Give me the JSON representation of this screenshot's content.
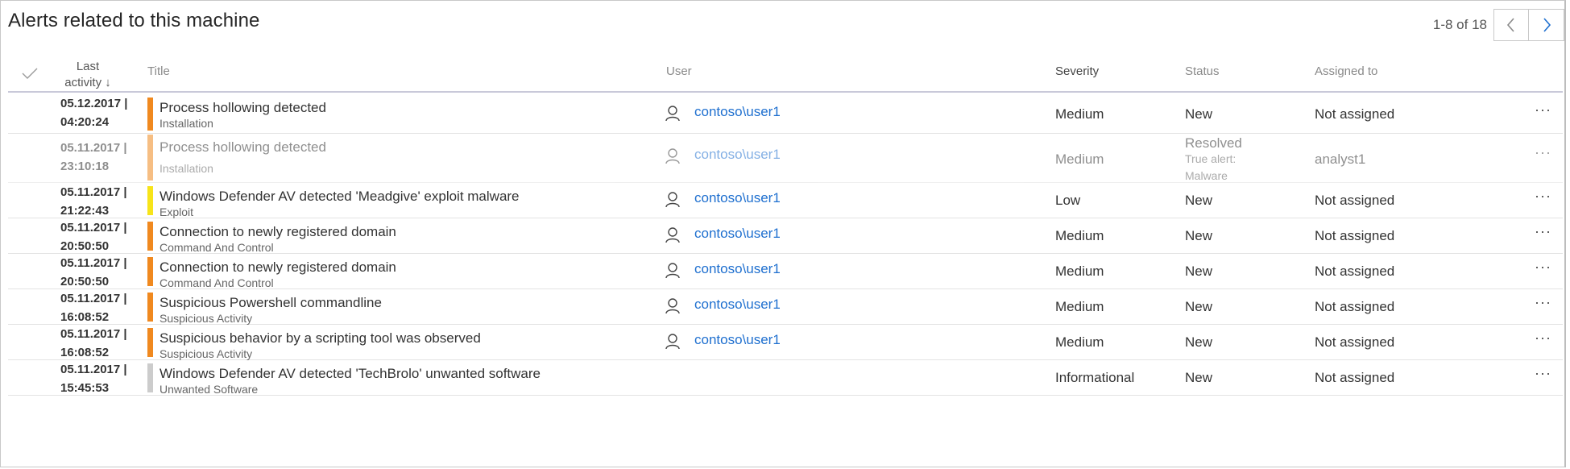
{
  "header": {
    "title": "Alerts related to this machine",
    "pager_text": "1-8 of 18"
  },
  "columns": {
    "activity_line1": "Last",
    "activity_line2": "activity ↓",
    "title": "Title",
    "user": "User",
    "severity": "Severity",
    "status": "Status",
    "assigned": "Assigned to"
  },
  "icons": {
    "select_all": "checkmark-icon",
    "prev": "chevron-left-icon",
    "next": "chevron-right-icon",
    "user": "user-icon",
    "more": "more-icon"
  },
  "colors": {
    "severity_medium": "#f0891f",
    "severity_low": "#f7e41a",
    "severity_informational": "#cccccc",
    "link": "#1e6fcf"
  },
  "more_glyph": "···",
  "rows": [
    {
      "date": "05.12.2017 |",
      "time": "04:20:24",
      "title": "Process hollowing detected",
      "category": "Installation",
      "user": "contoso\\user1",
      "severity": "Medium",
      "status": "New",
      "status_detail1": "",
      "status_detail2": "",
      "assigned": "Not assigned",
      "bar_color": "#f0891f",
      "dimmed": false
    },
    {
      "date": "05.11.2017 |",
      "time": "23:10:18",
      "title": "Process hollowing detected",
      "category": "Installation",
      "user": "contoso\\user1",
      "severity": "Medium",
      "status": "Resolved",
      "status_detail1": "True alert:",
      "status_detail2": "Malware",
      "assigned": "analyst1",
      "bar_color": "#f0891f",
      "dimmed": true
    },
    {
      "date": "05.11.2017 |",
      "time": "21:22:43",
      "title": "Windows Defender AV detected 'Meadgive' exploit malware",
      "category": "Exploit",
      "user": "contoso\\user1",
      "severity": "Low",
      "status": "New",
      "status_detail1": "",
      "status_detail2": "",
      "assigned": "Not assigned",
      "bar_color": "#f7e41a",
      "dimmed": false
    },
    {
      "date": "05.11.2017 |",
      "time": "20:50:50",
      "title": "Connection to newly registered domain",
      "category": "Command And Control",
      "user": "contoso\\user1",
      "severity": "Medium",
      "status": "New",
      "status_detail1": "",
      "status_detail2": "",
      "assigned": "Not assigned",
      "bar_color": "#f0891f",
      "dimmed": false
    },
    {
      "date": "05.11.2017 |",
      "time": "20:50:50",
      "title": "Connection to newly registered domain",
      "category": "Command And Control",
      "user": "contoso\\user1",
      "severity": "Medium",
      "status": "New",
      "status_detail1": "",
      "status_detail2": "",
      "assigned": "Not assigned",
      "bar_color": "#f0891f",
      "dimmed": false
    },
    {
      "date": "05.11.2017 |",
      "time": "16:08:52",
      "title": "Suspicious Powershell commandline",
      "category": "Suspicious Activity",
      "user": "contoso\\user1",
      "severity": "Medium",
      "status": "New",
      "status_detail1": "",
      "status_detail2": "",
      "assigned": "Not assigned",
      "bar_color": "#f0891f",
      "dimmed": false
    },
    {
      "date": "05.11.2017 |",
      "time": "16:08:52",
      "title": "Suspicious behavior by a scripting tool was observed",
      "category": "Suspicious Activity",
      "user": "contoso\\user1",
      "severity": "Medium",
      "status": "New",
      "status_detail1": "",
      "status_detail2": "",
      "assigned": "Not assigned",
      "bar_color": "#f0891f",
      "dimmed": false
    },
    {
      "date": "05.11.2017 |",
      "time": "15:45:53",
      "title": "Windows Defender AV detected 'TechBrolo' unwanted software",
      "category": "Unwanted Software",
      "user": "",
      "severity": "Informational",
      "status": "New",
      "status_detail1": "",
      "status_detail2": "",
      "assigned": "Not assigned",
      "bar_color": "#cccccc",
      "dimmed": false
    }
  ]
}
